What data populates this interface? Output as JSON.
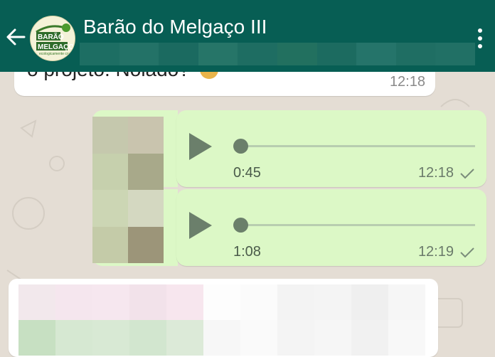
{
  "header": {
    "title": "Barão do Melgaço III",
    "avatar_logo_text": [
      "BARÃO",
      "MELGAÇO",
      "ecologicamente correto"
    ]
  },
  "incoming_message": {
    "text": "o projeto. Nolado?",
    "time": "12:18"
  },
  "voice_messages": [
    {
      "duration": "0:45",
      "time": "12:18",
      "progress": 0
    },
    {
      "duration": "1:08",
      "time": "12:19",
      "progress": 0
    }
  ],
  "colors": {
    "header": "#075e54",
    "outgoing_bubble": "#dcf8c6",
    "incoming_bubble": "#ffffff",
    "wallpaper": "#e4ddd4"
  },
  "icons": {
    "back": "arrow-left-icon",
    "menu": "more-vertical-icon",
    "play": "play-icon",
    "tick": "check-icon"
  }
}
